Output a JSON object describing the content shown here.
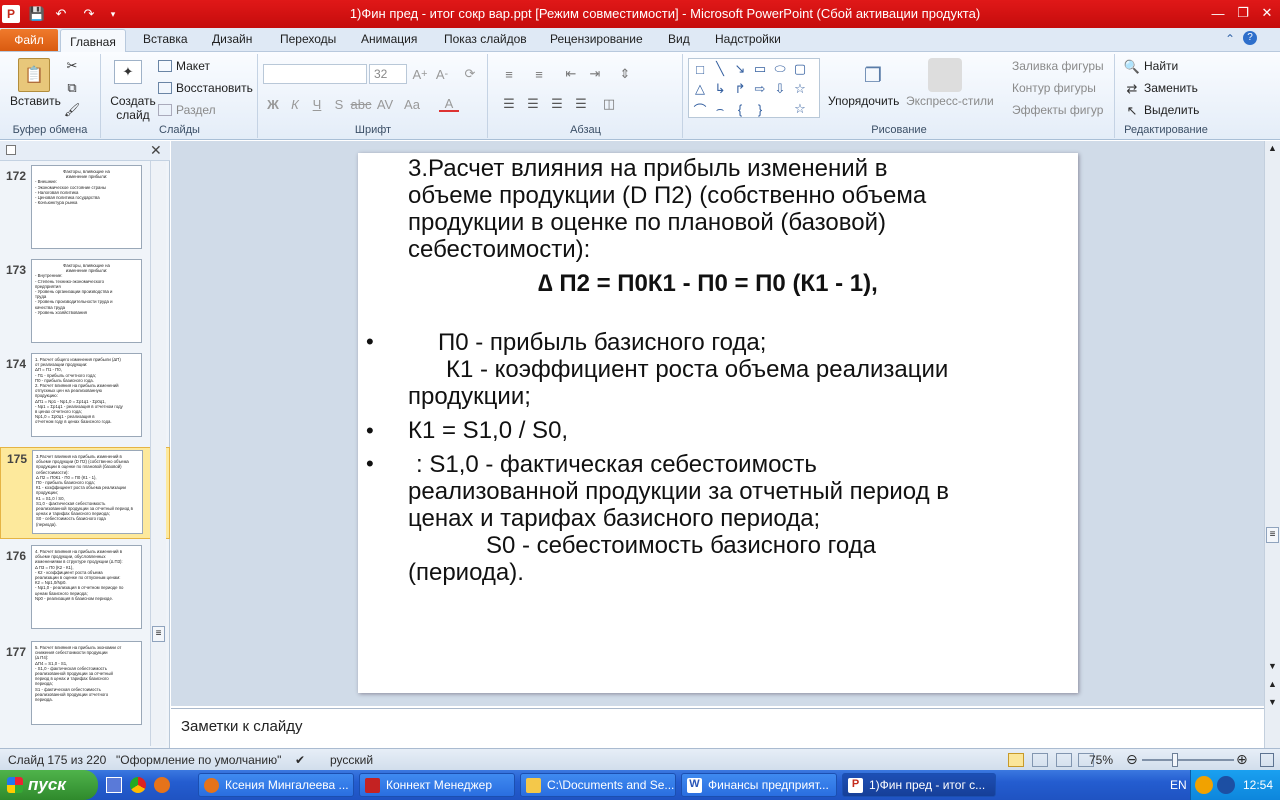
{
  "window": {
    "title": "1)Фин пред - итог сокр вар.ppt [Режим совместимости] - Microsoft PowerPoint (Сбой активации продукта)",
    "app_icon": "P"
  },
  "tabs": [
    "Файл",
    "Главная",
    "Вставка",
    "Дизайн",
    "Переходы",
    "Анимация",
    "Показ слайдов",
    "Рецензирование",
    "Вид",
    "Надстройки"
  ],
  "ribbon": {
    "clipboard": {
      "paste": "Вставить",
      "label": "Буфер обмена"
    },
    "slides": {
      "new_slide": "Создать слайд",
      "layout": "Макет",
      "reset": "Восстановить",
      "section": "Раздел",
      "label": "Слайды"
    },
    "font": {
      "name_value": "",
      "size_value": "32",
      "label": "Шрифт"
    },
    "paragraph": {
      "label": "Абзац"
    },
    "drawing": {
      "arrange": "Упорядочить",
      "quick_styles": "Экспресс-стили",
      "fill": "Заливка фигуры",
      "outline": "Контур фигуры",
      "effects": "Эффекты фигур",
      "label": "Рисование"
    },
    "editing": {
      "find": "Найти",
      "replace": "Заменить",
      "select": "Выделить",
      "label": "Редактирование"
    }
  },
  "thumbnails": [
    {
      "num": "172",
      "lines": [
        "Факторы, влияющие на",
        "изменение прибыли:",
        "- Внешние:",
        "- Экономическое состояние страны",
        "- Налоговая политика",
        "- Ценовая политика государства",
        "- Конъюнктура рынка"
      ]
    },
    {
      "num": "173",
      "lines": [
        "Факторы, влияющие на",
        "изменение прибыли:",
        "- Внутренние:",
        "- Степень технико-экономического",
        "предприятия",
        "- Уровень организации производства и",
        "труда",
        "- Уровень производительности труда и",
        "качества труда",
        "- Уровень хозяйствования"
      ]
    },
    {
      "num": "174",
      "lines": [
        "1. Расчет общего изменения прибыли (ΔП)",
        "от реализации продукции:",
        "ΔП = П1 - П0,",
        "- П1 - прибыль отчетного года;",
        "П0 - прибыль базисного года.",
        "2. Расчет влияния на прибыль изменений",
        "отпускных цен на реализованную",
        "продукцию:",
        "ΔП1 = Nр1 - Nр1,0 = Σp1q1 - Σp0q1,",
        "- Nр1 = Σp1q1 - реализация в отчетном году",
        "в ценах отчетного года;",
        "Nр1,0 = Σp0q1 - реализация в",
        "отчетном году в ценах базисного года."
      ]
    },
    {
      "num": "175",
      "lines": [
        "3.Расчет влияния на прибыль изменений в",
        "объеме продукции (D П2) (собственно объема",
        "продукции в оценке по плановой (базовой)",
        "себестоимости):",
        "Δ П2 = П0К1 - П0 = П0 (К1 - 1),",
        "П0 - прибыль базисного года;",
        "К1 - коэффициент роста объема реализации",
        "продукции;",
        "К1 = S1,0 / S0,",
        "S1,0 - фактическая себестоимость",
        "реализованной продукции за отчетный период в",
        "ценах и тарифах базисного периода;",
        "S0 - себестоимость базисного года",
        "(периода)."
      ]
    },
    {
      "num": "176",
      "lines": [
        "4. Расчет влияния на прибыль изменений в",
        "объеме продукции, обусловленных",
        "изменениями в структуре продукции (Δ П3):",
        "Δ П3 = П0 (К2 - К1),",
        "- К2 - коэффициент роста объема",
        "реализации в оценке по отпускным ценам:",
        "К2 = Nр1,0/Nр0.",
        "- Nр1,0 - реализация в отчетном периоде по",
        "ценам базисного периода;",
        "Nр0 - реализация в базисном периоде."
      ]
    },
    {
      "num": "177",
      "lines": [
        "5. Расчет влияния на прибыль экономии от",
        "снижения себестоимости продукции",
        "(Δ П4):",
        "ΔП4 = S1,0 - S1,",
        "- S1,0 - фактическая себестоимость",
        "реализованной продукции за отчетный",
        "период в ценах и тарифах базисного",
        "периода;",
        "S1 - фактическая себестоимость",
        "реализованной продукции отчетного",
        "периода."
      ]
    }
  ],
  "slide": {
    "heading_lines": [
      "3.Расчет влияния на прибыль изменений в",
      "объеме продукции (D  П2) (собственно объема",
      "продукции в оценке по плановой (базовой)",
      "себестоимости):"
    ],
    "formula": "∆ П2 = П0К1 - П0 = П0 (К1 - 1),",
    "bullet1_lines": [
      "П0 - прибыль базисного года;",
      "К1 - коэффициент роста объема реализации",
      "продукции;"
    ],
    "bullet2": "К1 = S1,0 / S0,",
    "bullet3_lines": [
      ":   S1,0 - фактическая себестоимость",
      "реализованной продукции за отчетный период в",
      "ценах и тарифах базисного периода;",
      "S0 - себестоимость базисного года",
      "(периода)."
    ],
    "bullet_char": "•"
  },
  "notes": {
    "placeholder": "Заметки к слайду"
  },
  "status": {
    "slide": "Слайд 175 из 220",
    "theme": "\"Оформление по умолчанию\"",
    "lang": "русский",
    "zoom": "75%",
    "zoom_level": 0.75
  },
  "taskbar": {
    "start": "пуск",
    "tasks": [
      "Ксения Мингалеева ...",
      "Коннект Менеджер",
      "C:\\Documents and Se...",
      "Финансы предприят...",
      "1)Фин пред - итог с..."
    ],
    "lang": "EN",
    "time": "12:54"
  },
  "colors": {
    "titlebar": "#d01010",
    "file_tab": "#e86a1e",
    "selected_thumb": "#fde99c",
    "taskbar": "#245dd0",
    "start": "#3b9b37"
  }
}
